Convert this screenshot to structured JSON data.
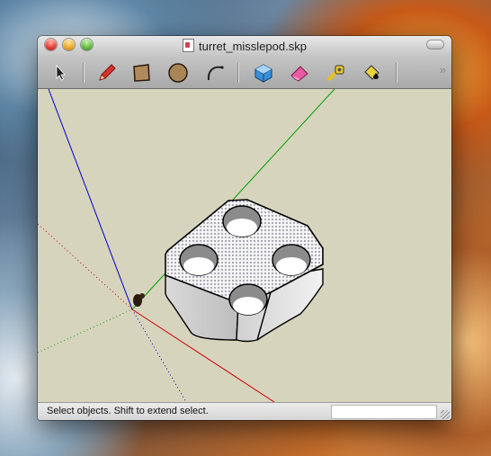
{
  "window": {
    "title": "turret_misslepod.skp"
  },
  "toolbar": {
    "tools": [
      {
        "name": "select",
        "icon": "arrow-cursor-icon"
      },
      {
        "name": "pencil",
        "icon": "pencil-icon"
      },
      {
        "name": "rectangle",
        "icon": "rectangle-icon"
      },
      {
        "name": "circle",
        "icon": "circle-icon"
      },
      {
        "name": "arc",
        "icon": "arc-icon"
      },
      {
        "name": "make-component",
        "icon": "component-box-icon"
      },
      {
        "name": "eraser",
        "icon": "eraser-icon"
      },
      {
        "name": "tape-measure",
        "icon": "tape-measure-icon"
      },
      {
        "name": "paint-bucket",
        "icon": "paint-bucket-icon"
      }
    ],
    "overflow_label": "»"
  },
  "status": {
    "text": "Select objects. Shift to extend select.",
    "measurements_value": ""
  },
  "colors": {
    "viewport_bg": "#d7d4bd",
    "axis_red": "#cc0000",
    "axis_green": "#00a000",
    "axis_blue": "#0000cc",
    "model_face": "#eaeaea"
  }
}
